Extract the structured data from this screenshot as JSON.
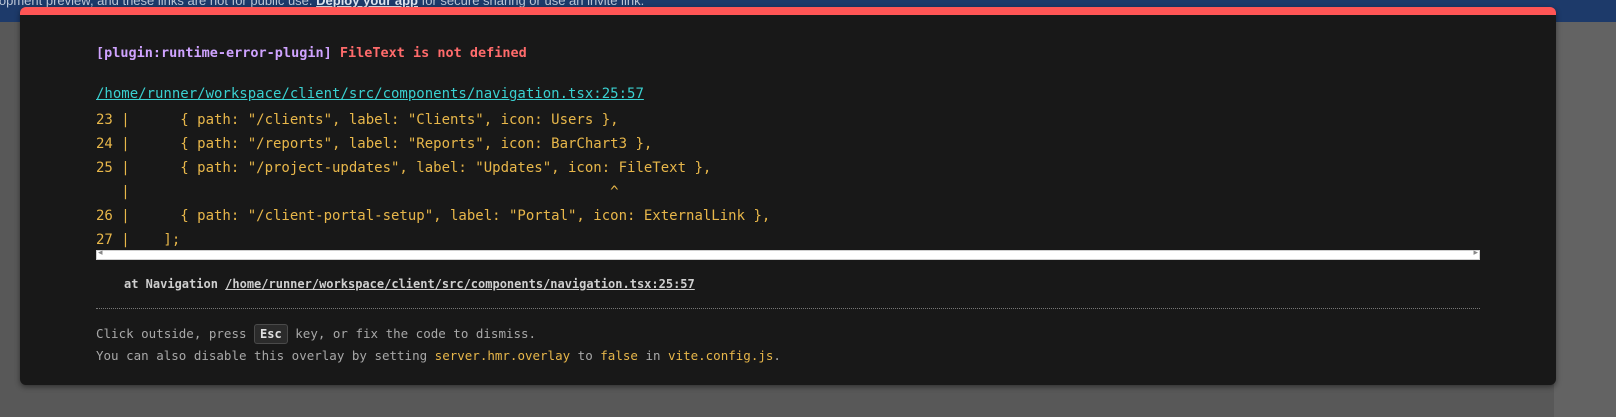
{
  "banner": {
    "text_before": "lopment preview, and these links are not for public use.",
    "link": "Deploy your app",
    "text_after": "for secure sharing or use an invite link."
  },
  "error": {
    "plugin": "[plugin:runtime-error-plugin]",
    "message": "FileText is not defined",
    "file": "/home/runner/workspace/client/src/components/navigation.tsx:25:57",
    "frame_lines": [
      "23 |      { path: \"/clients\", label: \"Clients\", icon: Users },",
      "24 |      { path: \"/reports\", label: \"Reports\", icon: BarChart3 },",
      "25 |      { path: \"/project-updates\", label: \"Updates\", icon: FileText },",
      "   |                                                         ^",
      "26 |      { path: \"/client-portal-setup\", label: \"Portal\", icon: ExternalLink },",
      "27 |    ];"
    ],
    "stack_prefix": "at Navigation",
    "stack_location": "/home/runner/workspace/client/src/components/navigation.tsx:25:57"
  },
  "tips": {
    "line1_before": "Click outside, press",
    "key": "Esc",
    "line1_after": "key, or fix the code to dismiss.",
    "line2_before": "You can also disable this overlay by setting",
    "setting": "server.hmr.overlay",
    "line2_mid": "to",
    "value": "false",
    "line2_in": "in",
    "config_file": "vite.config.js",
    "line2_end": "."
  },
  "colors": {
    "accent_bar": "#ff5555",
    "plugin": "#cfa3ff",
    "error": "#ff6b6b",
    "link": "#3ad1d1",
    "code": "#e8b74a"
  },
  "icons": {
    "scroll_left": "arrow-left-icon",
    "scroll_right": "arrow-right-icon"
  }
}
